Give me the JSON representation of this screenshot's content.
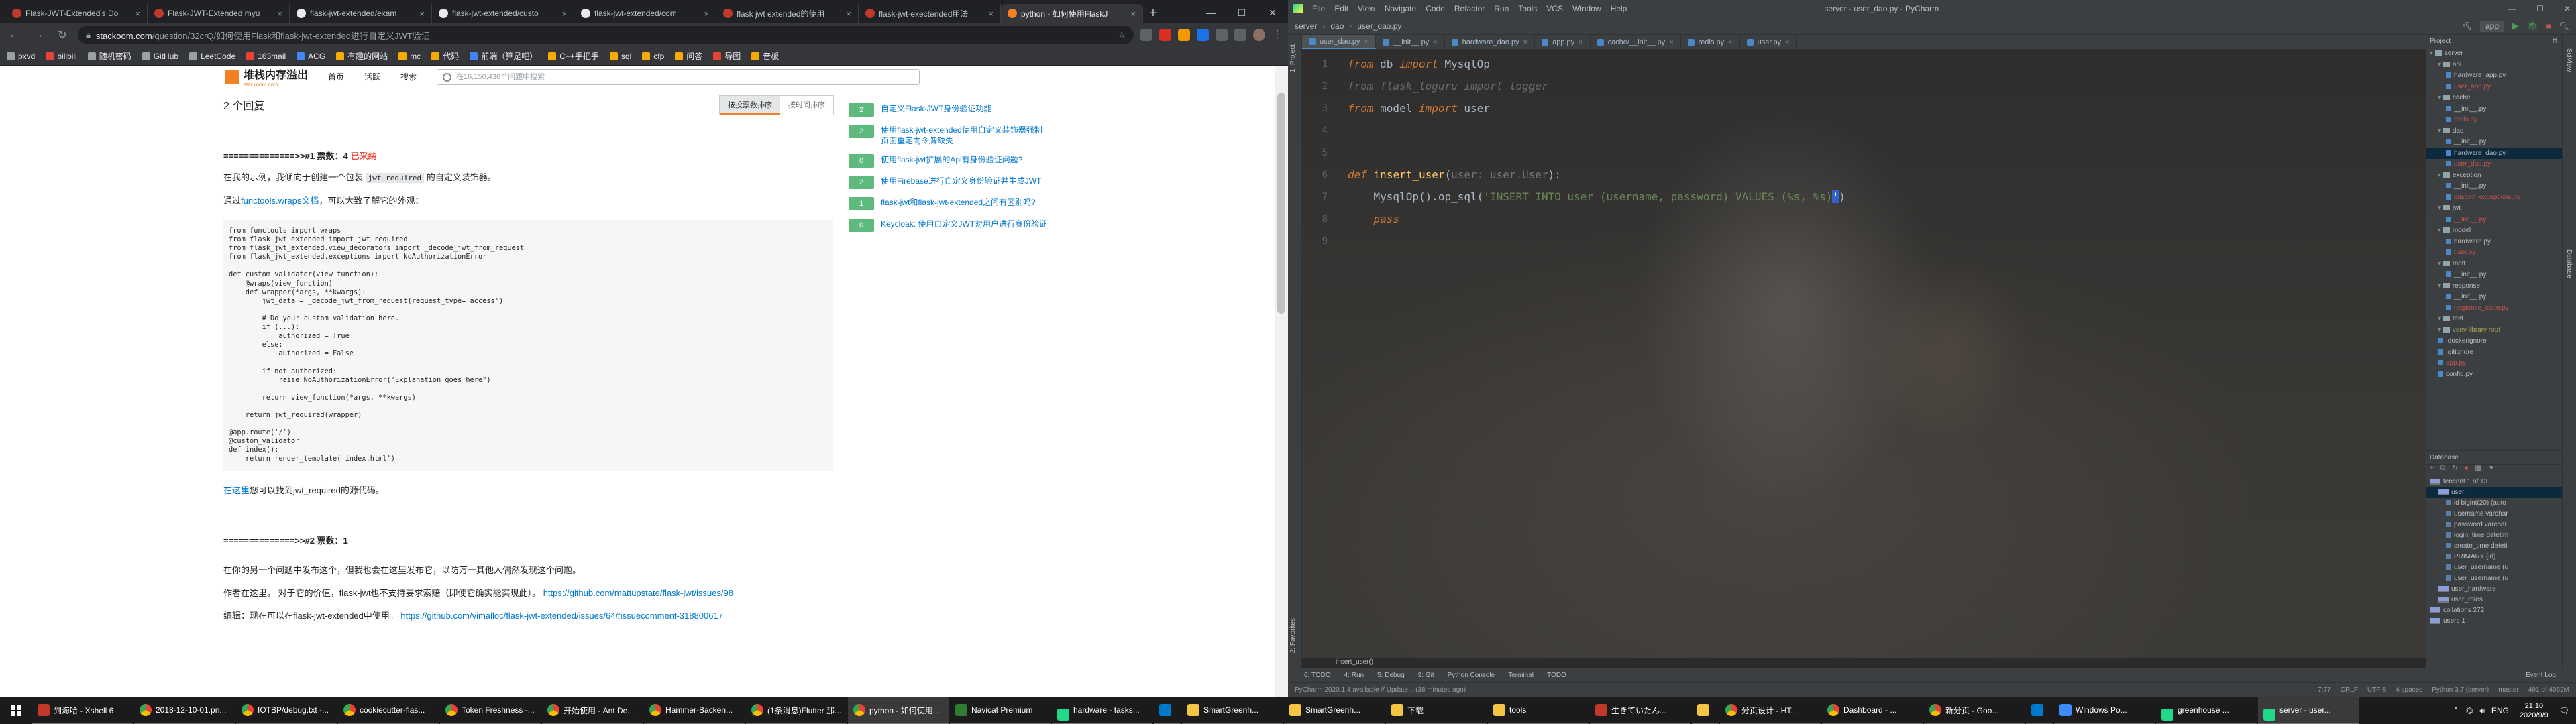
{
  "browser": {
    "tabs": [
      {
        "title": "Flask-JWT-Extended's Do",
        "icon": "red"
      },
      {
        "title": "Flask-JWT-Extended myu",
        "icon": "red"
      },
      {
        "title": "flask-jwt-extended/exam",
        "icon": "gh"
      },
      {
        "title": "flask-jwt-extended/custo",
        "icon": "gh"
      },
      {
        "title": "flask-jwt-extended/com",
        "icon": "gh"
      },
      {
        "title": "flask jwt extended的使用",
        "icon": "red"
      },
      {
        "title": "flask-jwt-exectended用法",
        "icon": "red"
      },
      {
        "title": "python - 如何使用FlaskJ",
        "icon": "so",
        "active": true
      }
    ],
    "url_domain": "stackoom.com",
    "url_path": "/question/32crQ/如何使用Flask和flask-jwt-extended进行自定义JWT验证",
    "bookmarks": [
      "pxvd",
      "bilibili",
      "随机密码",
      "GitHub",
      "LeetCode",
      "163mail",
      "ACG",
      "有趣的网站",
      "mc",
      "代码",
      "前端（算是吧）",
      "C++手把手",
      "sql",
      "cfp",
      "问答",
      "导图",
      "音板"
    ]
  },
  "site": {
    "logo_title": "堆栈内存溢出",
    "logo_sub": "stackoom.com",
    "nav": [
      "首页",
      "活跃",
      "搜索"
    ],
    "search_placeholder": "在16,150,436个问题中搜索"
  },
  "question": {
    "answer_count": "2 个回复",
    "sort_tabs": [
      "按投票数排序",
      "按时间排序"
    ],
    "answer1_heading": "==============>>#1 票数：4",
    "answer1_accepted": "已采纳",
    "a1_p1_pre": "在我的示例，我倾向于创建一个包装",
    "a1_p1_code": "jwt_required",
    "a1_p1_post": "的自定义装饰器。",
    "a1_p2_pre": "通过",
    "a1_p2_link": "functools.wraps文档",
    "a1_p2_post": "，可以大致了解它的外观：",
    "code_block": "from functools import wraps\nfrom flask_jwt_extended import jwt_required\nfrom flask_jwt_extended.view_decorators import _decode_jwt_from_request\nfrom flask_jwt_extended.exceptions import NoAuthorizationError\n\ndef custom_validator(view_function):\n    @wraps(view_function)\n    def wrapper(*args, **kwargs):\n        jwt_data = _decode_jwt_from_request(request_type='access')\n\n        # Do your custom validation here.\n        if (...):\n            authorized = True\n        else:\n            authorized = False\n\n        if not authorized:\n            raise NoAuthorizationError(\"Explanation goes here\")\n\n        return view_function(*args, **kwargs)\n\n    return jwt_required(wrapper)\n\n@app.route('/')\n@custom_validator\ndef index():\n    return render_template('index.html')",
    "a1_p3_link": "在这里",
    "a1_p3_post": "您可以找到jwt_required的源代码。",
    "answer2_heading": "==============>>#2 票数：1",
    "a2_p1": "在你的另一个问题中发布这个，但我也会在这里发布它，以防万一其他人偶然发现这个问题。",
    "a2_p2_pre": "作者在这里。 对于它的价值，flask-jwt也不支持要求索赔（即使它确实能实现此）。",
    "a2_p2_link": "https://github.com/mattupstate/flask-jwt/issues/98",
    "a2_p3_pre": "编辑：现在可以在flask-jwt-extended中使用。",
    "a2_p3_link": "https://github.com/vimalloc/flask-jwt-extended/issues/64#issuecomment-318800617"
  },
  "related": [
    {
      "score": "2",
      "title": "自定义Flask-JWT身份验证功能"
    },
    {
      "score": "2",
      "title": "使用flask-jwt-extended使用自定义装饰器强制页面重定向令牌缺失"
    },
    {
      "score": "0",
      "title": "使用flask-jwt扩展的Api有身份验证问题?"
    },
    {
      "score": "2",
      "title": "使用Firebase进行自定义身份验证并生成JWT"
    },
    {
      "score": "1",
      "title": "flask-jwt和flask-jwt-extended之间有区别吗?"
    },
    {
      "score": "0",
      "title": "Keycloak: 使用自定义JWT对用户进行身份验证"
    }
  ],
  "ide": {
    "menu": [
      "File",
      "Edit",
      "View",
      "Navigate",
      "Code",
      "Refactor",
      "Run",
      "Tools",
      "VCS",
      "Window",
      "Help"
    ],
    "window_title": "server - user_dao.py - PyCharm",
    "breadcrumbs": [
      "server",
      "dao",
      "user_dao.py"
    ],
    "run_config": "app",
    "editor_tabs": [
      "user_dao.py",
      "__init__.py",
      "hardware_dao.py",
      "app.py",
      "cache/__init__.py",
      "redis.py",
      "user.py"
    ],
    "active_tab": 0,
    "code_lines": [
      {
        "n": "1",
        "html": "<span class='kw'>from</span> db <span class='kw'>import</span> MysqlOp"
      },
      {
        "n": "2",
        "html": "<span class='dim'>from flask_loguru import logger</span>"
      },
      {
        "n": "3",
        "html": "<span class='kw'>from</span> model <span class='kw'>import</span> user"
      },
      {
        "n": "4",
        "html": ""
      },
      {
        "n": "5",
        "html": ""
      },
      {
        "n": "6",
        "html": "<span class='kw'>def</span> <span class='fn'>insert_user</span>(<span class='prm'>user: user.User</span>):"
      },
      {
        "n": "7",
        "html": "    MysqlOp().op_sql(<span class='str'>'INSERT INTO user (username, password) VALUES (%s, %s)</span><span class='cursor'>'</span>)"
      },
      {
        "n": "8",
        "html": "    <span class='kw'>pass</span>"
      },
      {
        "n": "9",
        "html": ""
      }
    ],
    "editor_breadcrumb": "insert_user()",
    "project_header": "Project",
    "project_tree": [
      {
        "t": "server",
        "d": 0,
        "k": "fd"
      },
      {
        "t": "api",
        "d": 1,
        "k": "fd"
      },
      {
        "t": "hardware_app.py",
        "d": 2,
        "k": "pf"
      },
      {
        "t": "user_app.py",
        "d": 2,
        "k": "pf",
        "c": "red"
      },
      {
        "t": "cache",
        "d": 1,
        "k": "fd"
      },
      {
        "t": "__init__.py",
        "d": 2,
        "k": "pf"
      },
      {
        "t": "redis.py",
        "d": 2,
        "k": "pf",
        "c": "red"
      },
      {
        "t": "dao",
        "d": 1,
        "k": "fd"
      },
      {
        "t": "__init__.py",
        "d": 2,
        "k": "pf"
      },
      {
        "t": "hardware_dao.py",
        "d": 2,
        "k": "pf",
        "sel": true
      },
      {
        "t": "user_dao.py",
        "d": 2,
        "k": "pf",
        "c": "red"
      },
      {
        "t": "exception",
        "d": 1,
        "k": "fd"
      },
      {
        "t": "__init__.py",
        "d": 2,
        "k": "pf"
      },
      {
        "t": "custom_exceptions.py",
        "d": 2,
        "k": "pf",
        "c": "red"
      },
      {
        "t": "jwt",
        "d": 1,
        "k": "fd"
      },
      {
        "t": "__init__.py",
        "d": 2,
        "k": "pf",
        "c": "red"
      },
      {
        "t": "model",
        "d": 1,
        "k": "fd"
      },
      {
        "t": "hardware.py",
        "d": 2,
        "k": "pf"
      },
      {
        "t": "user.py",
        "d": 2,
        "k": "pf",
        "c": "red"
      },
      {
        "t": "mqtt",
        "d": 1,
        "k": "fd"
      },
      {
        "t": "__init__.py",
        "d": 2,
        "k": "pf"
      },
      {
        "t": "response",
        "d": 1,
        "k": "fd"
      },
      {
        "t": "__init__.py",
        "d": 2,
        "k": "pf"
      },
      {
        "t": "response_code.py",
        "d": 2,
        "k": "pf",
        "c": "red"
      },
      {
        "t": "test",
        "d": 1,
        "k": "fd"
      },
      {
        "t": "venv  library root",
        "d": 1,
        "k": "fd",
        "c": "yel"
      },
      {
        "t": ".dockerignore",
        "d": 1,
        "k": "pf"
      },
      {
        "t": ".gitignore",
        "d": 1,
        "k": "pf"
      },
      {
        "t": "app.py",
        "d": 1,
        "k": "pf",
        "c": "red"
      },
      {
        "t": "config.py",
        "d": 1,
        "k": "pf"
      }
    ],
    "db_header": "Database",
    "db_tree": [
      {
        "t": "tencent  1 of 13",
        "d": 0,
        "k": "tb"
      },
      {
        "t": "user",
        "d": 1,
        "k": "tb",
        "sel": true
      },
      {
        "t": "id  bigint(20) (auto",
        "d": 2,
        "k": "co"
      },
      {
        "t": "username  varchar",
        "d": 2,
        "k": "co"
      },
      {
        "t": "password  varchar",
        "d": 2,
        "k": "co"
      },
      {
        "t": "login_time  datetim",
        "d": 2,
        "k": "co"
      },
      {
        "t": "create_time  dateti",
        "d": 2,
        "k": "co"
      },
      {
        "t": "PRIMARY  (id)",
        "d": 2,
        "k": "co"
      },
      {
        "t": "user_username  (u",
        "d": 2,
        "k": "co"
      },
      {
        "t": "user_username  (u",
        "d": 2,
        "k": "co"
      },
      {
        "t": "user_hardware",
        "d": 1,
        "k": "tb"
      },
      {
        "t": "user_roles",
        "d": 1,
        "k": "tb"
      },
      {
        "t": "collations  272",
        "d": 0,
        "k": "fd"
      },
      {
        "t": "users  1",
        "d": 0,
        "k": "fd"
      }
    ],
    "bottom_tools": [
      "6: TODO",
      "4: Run",
      "5: Debug",
      "9: Git",
      "Python Console",
      "Terminal",
      "TODO"
    ],
    "event_log": "Event Log",
    "status_left": "PyCharm 2020.1.4 available // Update... (38 minutes ago)",
    "status_right": [
      "7:77",
      "CRLF",
      "UTF-8",
      "4 spaces",
      "Python 3.7 (server)",
      "master",
      "491 of 4062M"
    ]
  },
  "taskbar": {
    "apps": [
      {
        "t": "到海哈 - Xshell 6",
        "ic": "x"
      },
      {
        "t": "2018-12-10-01.pn...",
        "ic": "ch"
      },
      {
        "t": "IOTBP/debug.txt -...",
        "ic": "ch"
      },
      {
        "t": "cookiecutter-flas...",
        "ic": "ch"
      },
      {
        "t": "Token Freshness -...",
        "ic": "ch"
      },
      {
        "t": "开始使用 - Ant De...",
        "ic": "ch"
      },
      {
        "t": "Hammer-Backen...",
        "ic": "ch"
      },
      {
        "t": "(1条消息)Flutter 那...",
        "ic": "ch"
      },
      {
        "t": "python - 如何使用...",
        "ic": "ch",
        "active": true
      },
      {
        "t": "Navicat Premium",
        "ic": "n"
      },
      {
        "t": "hardware - tasks...",
        "ic": "p"
      },
      {
        "t": "",
        "ic": "v"
      },
      {
        "t": "SmartGreenh...",
        "ic": "f"
      },
      {
        "t": "SmartGreenh...",
        "ic": "f"
      },
      {
        "t": "下载",
        "ic": "f"
      },
      {
        "t": "tools",
        "ic": "f"
      },
      {
        "t": "生きていたん...",
        "ic": "x"
      },
      {
        "t": "",
        "ic": "f"
      },
      {
        "t": "分页设计 - HT...",
        "ic": "ch"
      },
      {
        "t": "Dashboard - ...",
        "ic": "ch"
      },
      {
        "t": "新分页 - Goo...",
        "ic": "ch"
      },
      {
        "t": "",
        "ic": "v"
      },
      {
        "t": "Windows Po...",
        "ic": "w"
      },
      {
        "t": "greenhouse ...",
        "ic": "p"
      },
      {
        "t": "server - user...",
        "ic": "p",
        "active": true
      }
    ],
    "ime": "ENG",
    "time": "21:10",
    "date": "2020/9/9"
  }
}
